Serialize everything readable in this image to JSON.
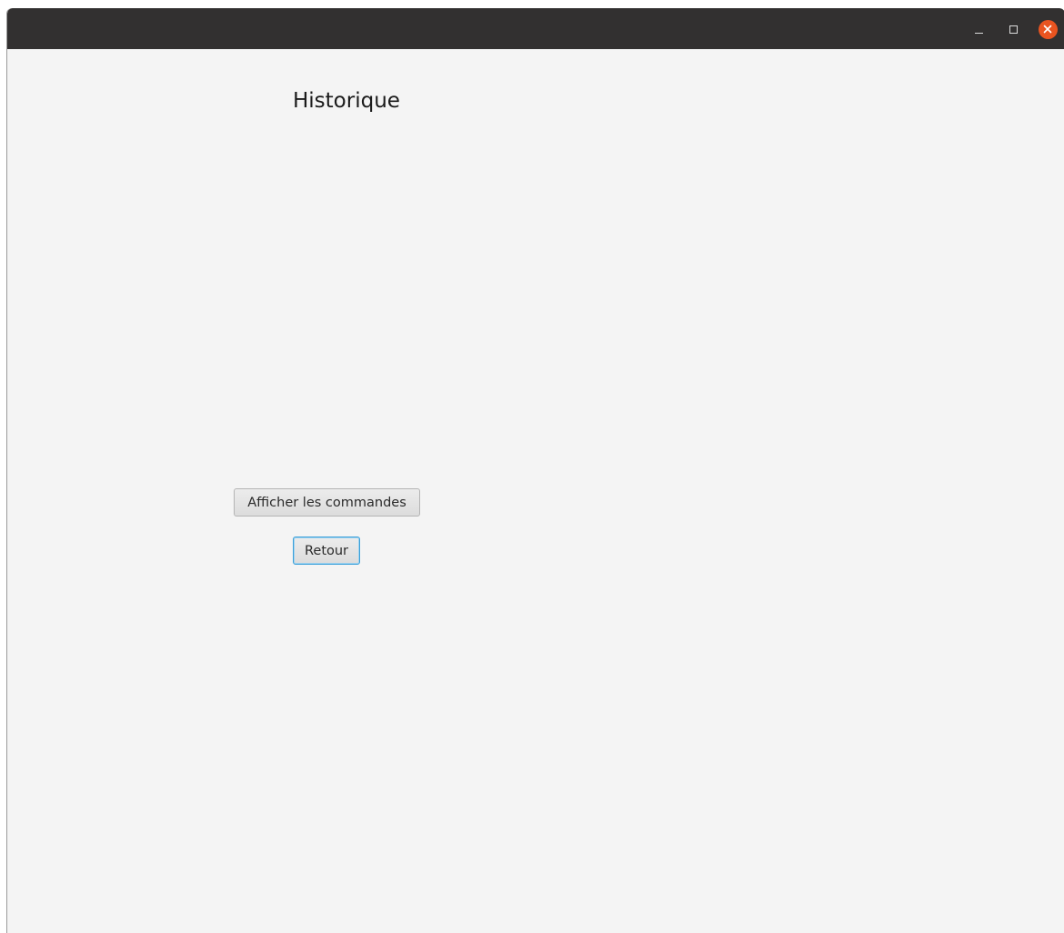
{
  "window": {
    "controls": {
      "minimize_icon": "minimize-icon",
      "maximize_icon": "maximize-icon",
      "close_icon": "close-icon"
    },
    "close_color": "#e95420"
  },
  "page": {
    "title": "Historique"
  },
  "actions": {
    "show_orders_label": "Afficher les commandes",
    "back_label": "Retour"
  }
}
